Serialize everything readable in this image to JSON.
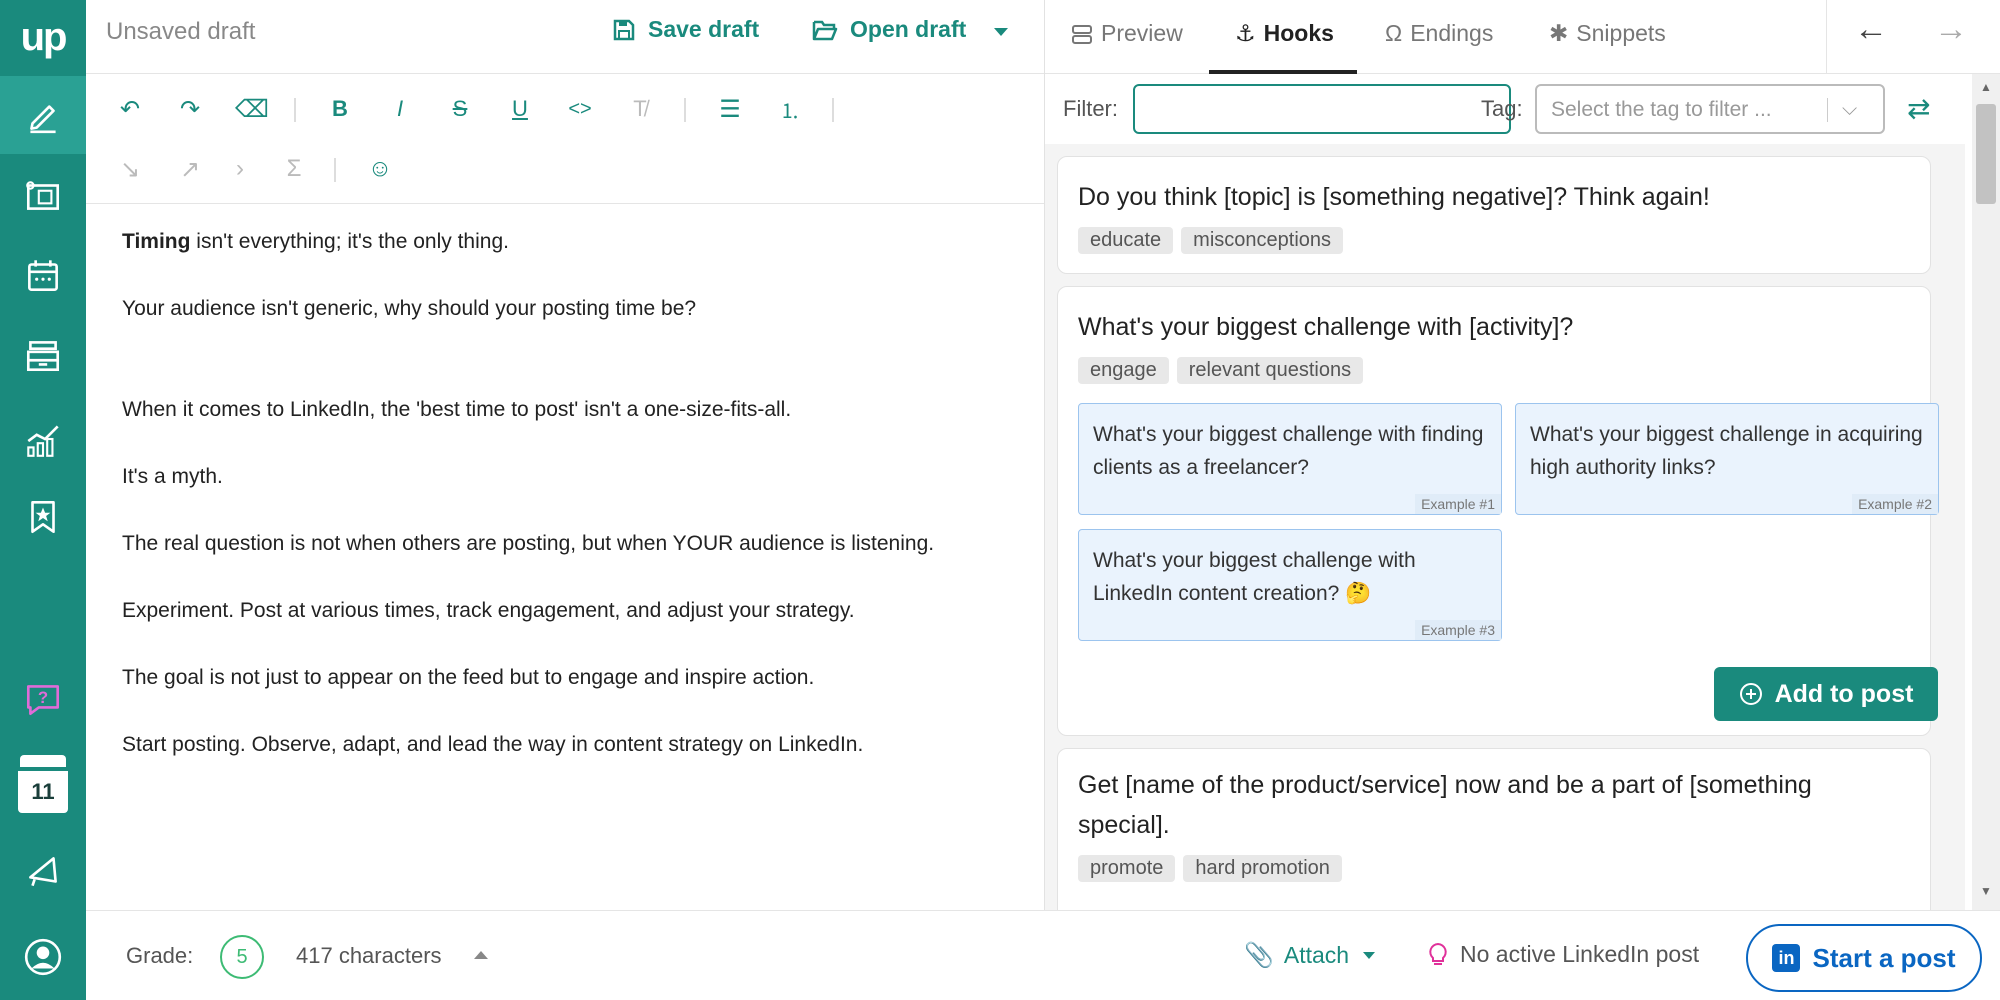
{
  "app": {
    "logo_text": "up",
    "draft_title": "Unsaved draft",
    "save_draft": "Save draft",
    "open_draft": "Open draft",
    "calendar_day": "11"
  },
  "right_panel": {
    "tabs": [
      {
        "label": "Preview",
        "active": false
      },
      {
        "label": "Hooks",
        "active": true
      },
      {
        "label": "Endings",
        "active": false
      },
      {
        "label": "Snippets",
        "active": false
      }
    ],
    "filter_label": "Filter:",
    "filter_value": "",
    "tag_label": "Tag:",
    "tag_placeholder": "Select the tag to filter ...",
    "hooks": [
      {
        "text": "Do you think [topic] is [something negative]? Think again!",
        "tags": [
          "educate",
          "misconceptions"
        ]
      },
      {
        "text": "What's your biggest challenge with [activity]?",
        "tags": [
          "engage",
          "relevant questions"
        ],
        "examples": [
          {
            "text": "What's your biggest challenge with finding clients as a freelancer?",
            "label": "Example #1"
          },
          {
            "text": "What's your biggest challenge in acquiring high authority links?",
            "label": "Example #2"
          },
          {
            "text": "What's your biggest challenge with LinkedIn content creation? 🤔",
            "label": "Example #3"
          }
        ],
        "add_label": "Add to post"
      },
      {
        "text": "Get [name of the product/service] now and be a part of [something special].",
        "tags": [
          "promote",
          "hard promotion"
        ]
      }
    ]
  },
  "editor": {
    "first_bold": "Timing",
    "first_rest": " isn't everything; it's the only thing.",
    "paragraphs": [
      "Your audience isn't generic, why should your posting time be?",
      "When it comes to LinkedIn, the 'best time to post' isn't a one-size-fits-all.",
      "It's a myth.",
      "The real question is not when others are posting, but when YOUR audience is listening.",
      "Experiment. Post at various times, track engagement, and adjust your strategy.",
      "The goal is not just to appear on the feed but to engage and inspire action.",
      "Start posting. Observe, adapt, and lead the way in content strategy on LinkedIn."
    ]
  },
  "bottom": {
    "grade_label": "Grade:",
    "grade_value": "5",
    "char_count": "417 characters",
    "attach": "Attach",
    "no_post": "No active LinkedIn post",
    "start_post": "Start a post",
    "li_logo": "in"
  },
  "colors": {
    "brand": "#1a8a7d",
    "linkedin": "#0a66c2",
    "grade": "#3dbb74"
  }
}
